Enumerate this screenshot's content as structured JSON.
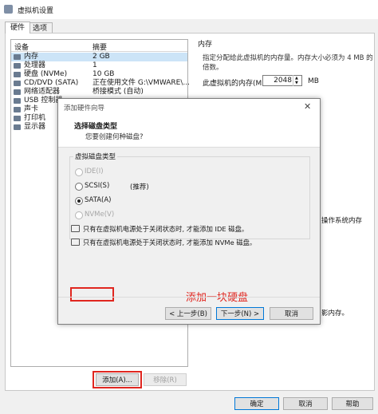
{
  "window": {
    "title": "虚拟机设置"
  },
  "tabs": [
    {
      "label": "硬件"
    },
    {
      "label": "选项"
    }
  ],
  "device_table": {
    "headers": [
      "设备",
      "摘要"
    ],
    "rows": [
      {
        "name": "内存",
        "summary": "2 GB",
        "icon": "memory-icon"
      },
      {
        "name": "处理器",
        "summary": "1",
        "icon": "cpu-icon"
      },
      {
        "name": "硬盘 (NVMe)",
        "summary": "10 GB",
        "icon": "disk-icon"
      },
      {
        "name": "CD/DVD (SATA)",
        "summary": "正在使用文件 G:\\VMWARE\\...",
        "icon": "cdrom-icon"
      },
      {
        "name": "网络适配器",
        "summary": "桥接模式 (自动)",
        "icon": "network-icon"
      },
      {
        "name": "USB 控制器",
        "summary": "",
        "icon": "usb-icon"
      },
      {
        "name": "声卡",
        "summary": "",
        "icon": "sound-icon"
      },
      {
        "name": "打印机",
        "summary": "",
        "icon": "printer-icon"
      },
      {
        "name": "显示器",
        "summary": "",
        "icon": "monitor-icon"
      }
    ]
  },
  "memory_panel": {
    "group_label": "内存",
    "description": "指定分配给此虚拟机的内存量。内存大小必须为 4 MB 的倍数。",
    "field_label": "此虚拟机的内存(M):",
    "value": "2048",
    "unit": "MB",
    "behind_text_1": "操作系统内存",
    "behind_text_2": "影内存。"
  },
  "wizard": {
    "title": "添加硬件向导",
    "heading": "选择磁盘类型",
    "subheading": "您要创建何种磁盘?",
    "group_label": "虚拟磁盘类型",
    "options": [
      {
        "label": "IDE(I)",
        "enabled": false,
        "selected": false
      },
      {
        "label": "SCSI(S)",
        "enabled": true,
        "selected": false,
        "note": "(推荐)"
      },
      {
        "label": "SATA(A)",
        "enabled": true,
        "selected": true
      },
      {
        "label": "NVMe(V)",
        "enabled": false,
        "selected": false
      }
    ],
    "annotation": "添加一块硬盘",
    "info_1": "只有在虚拟机电源处于关闭状态时, 才能添加 IDE 磁盘。",
    "info_2": "只有在虚拟机电源处于关闭状态时, 才能添加 NVMe 磁盘。",
    "back_label": "< 上一步(B)",
    "next_label": "下一步(N) >",
    "cancel_label": "取消"
  },
  "device_buttons": {
    "add_label": "添加(A)...",
    "remove_label": "移除(R)"
  },
  "footer": {
    "ok_label": "确定",
    "cancel_label": "取消",
    "help_label": "帮助"
  },
  "colors": {
    "annotation_red": "#e0261f",
    "selection_blue": "#cce4f7"
  }
}
